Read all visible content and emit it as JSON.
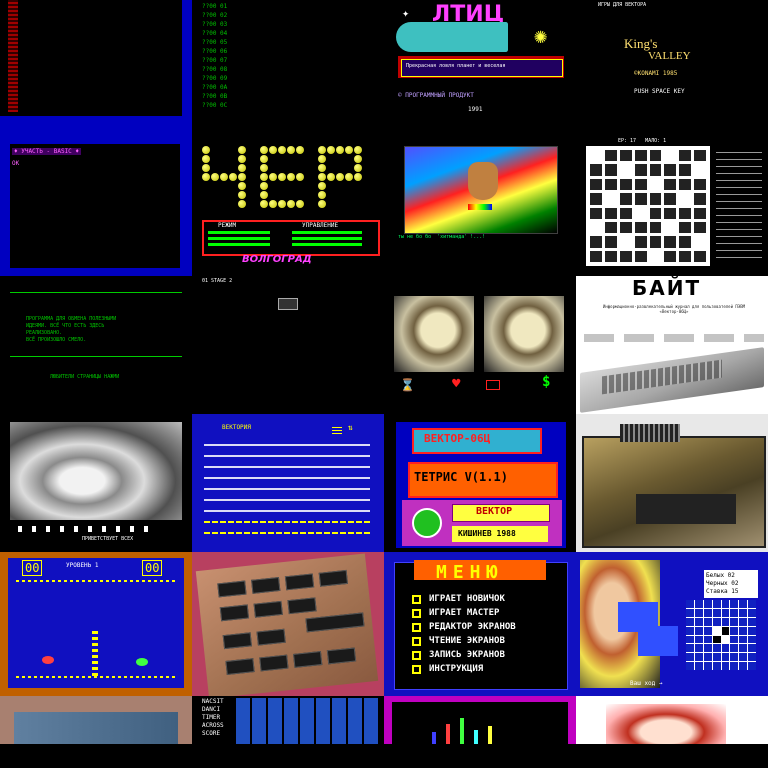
{
  "tiles": {
    "r0c1": {
      "lines": [
        "??00  01",
        "??00  02",
        "??00  03",
        "??00  04",
        "??00  05",
        "??00  06",
        "??00  07",
        "??00  08",
        "??00  09",
        "??00  0A",
        "??00  0B",
        "??00  0C"
      ]
    },
    "r0c2": {
      "title": "ЛТИЦ",
      "banner": "Прекрасная ловля планет и веселая",
      "credit": "© ПРОГРАММНЫЙ ПРОДУКТ",
      "year": "1991"
    },
    "r0c3": {
      "top": "ИГРЫ ДЛЯ ВЕКТОРА",
      "title1": "King's",
      "title2": "VALLEY",
      "subtitle": "©KONAMI 1985",
      "prompt": "PUSH SPACE KEY"
    },
    "r1c0": {
      "header": "♦ УЧАСТЬ - BASIC ♦"
    },
    "r1c1": {
      "title": "ЧЕР",
      "left_head": "РЕЖИМ",
      "right_head": "УПРАВЛЕНИЕ",
      "city": "ВОЛГОГРАД"
    },
    "r1c2": {
      "caption": "ты не бо бо  'хитманда' !...!"
    },
    "r1c3": {
      "score": "ЕР: 17   МАЛО: 1"
    },
    "r2c0": {
      "lines": [
        "ПРОГРАММА ДЛЯ ОБМЕНА ПОЛЕЗНЫМИ",
        "ИДЕЯМИ. ВСЁ ЧТО ЕСТЬ ЗДЕСЬ",
        "РЕАЛИЗОВАНО.",
        "ВСЁ ПРОИЗОШЛО СМЕЛО."
      ],
      "footer": "ЛЮБИТЕЛИ СТРАНИЦЫ НАЖМИ"
    },
    "r2c1": {
      "label": "01 STAGE 2"
    },
    "r2c3": {
      "title": "БАЙТ",
      "subtitle": "Информационно-развлекательный журнал для пользователей ПЭВМ «Вектор-06Ц»"
    },
    "r3c1": {
      "title": "ВЕКТОРИЯ"
    },
    "r3c2": {
      "title1": "ВЕКТОР-06Ц",
      "title2": "ТЕТРИС V(1.1)",
      "title3": "ВЕКТОР",
      "title4": "КИШИНЕВ 1988"
    },
    "r3c0": {
      "caption": "ПРИВЕТСТВУЕТ ВСЕХ"
    },
    "r4c0": {
      "score_left": "00",
      "level": "УРОВЕНЬ 1",
      "score_right": "00"
    },
    "r4c2": {
      "title": "МЕНЮ",
      "items": [
        "ИГРАЕТ НОВИЧОК",
        "ИГРАЕТ МАСТЕР",
        "РЕДАКТОР ЭКРАНОВ",
        "ЧТЕНИЕ ЭКРАНОВ",
        "ЗАПИСЬ ЭКРАНОВ",
        "ИНСТРУКЦИЯ"
      ]
    },
    "r4c3": {
      "stats": [
        "Белых  02",
        "Черных 02",
        "Ставка 15"
      ],
      "footer": "Ваш ход →"
    },
    "r5c1": {
      "lines": [
        "NACSIT",
        "DANCI",
        "TIMER",
        "ACROSS",
        "SCORE"
      ]
    }
  }
}
